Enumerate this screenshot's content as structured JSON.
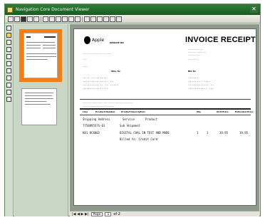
{
  "window": {
    "title": "Navigation Core Document Viewer",
    "close": "✕"
  },
  "toolbar": {
    "buttons": [
      "save-icon",
      "print-icon",
      "open-icon",
      "zoom-in-icon",
      "zoom-out-icon",
      "fit-page-icon",
      "fit-width-icon",
      "rotate-left-icon",
      "rotate-right-icon",
      "select-icon",
      "pan-icon",
      "first-page-icon",
      "prev-page-icon",
      "next-page-icon",
      "last-page-icon",
      "refresh-icon",
      "help-icon"
    ]
  },
  "status": {
    "nav": "|◀ ◀ ▶ ▶|",
    "page_label": "Page",
    "page_value": "1",
    "of": "of 2"
  },
  "invoice": {
    "brand": "Apple",
    "title": "INVOICE RECEIPT",
    "invoice_no_label": "INVOICE NO",
    "ship_to": "Ship To:",
    "bill_to": "Bill To:",
    "table_headers": [
      "Line",
      "Product Number",
      "Product Description",
      "Qty",
      "Unit Price",
      "Extended Price"
    ],
    "rows": [
      [
        "Shipping Address",
        "Service",
        "Product"
      ],
      [
        "7758895S7S-01",
        "Sub Shipment"
      ],
      [
        "K01 8C6002",
        "DIGITAL CHAL IN TEST AND MADE",
        "1",
        "1",
        "19.95",
        "19.95"
      ],
      [
        "",
        "Billed to: Credit Card"
      ]
    ]
  }
}
